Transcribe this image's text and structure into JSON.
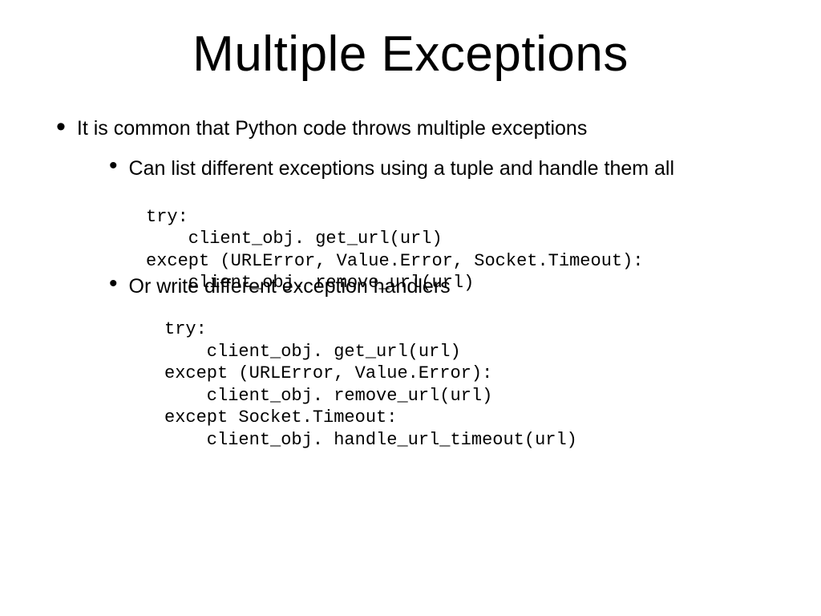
{
  "title": "Multiple Exceptions",
  "bullets": {
    "l1a": "It is common that Python code throws multiple exceptions",
    "l2a": "Can list different exceptions using a tuple and handle them all",
    "l2b": "Or write different exception handlers"
  },
  "code1_line1": "try:",
  "code1_line2": "    client_obj. get_url(url)",
  "code1_line3": "except (URLError, Value.Error, Socket.Timeout):",
  "code1_line4": "    client_obj. remove_url(url)",
  "code2_line1": "try:",
  "code2_line2": "    client_obj. get_url(url)",
  "code2_line3": "except (URLError, Value.Error):",
  "code2_line4": "    client_obj. remove_url(url)",
  "code2_line5": "except Socket.Timeout:",
  "code2_line6": "    client_obj. handle_url_timeout(url)"
}
